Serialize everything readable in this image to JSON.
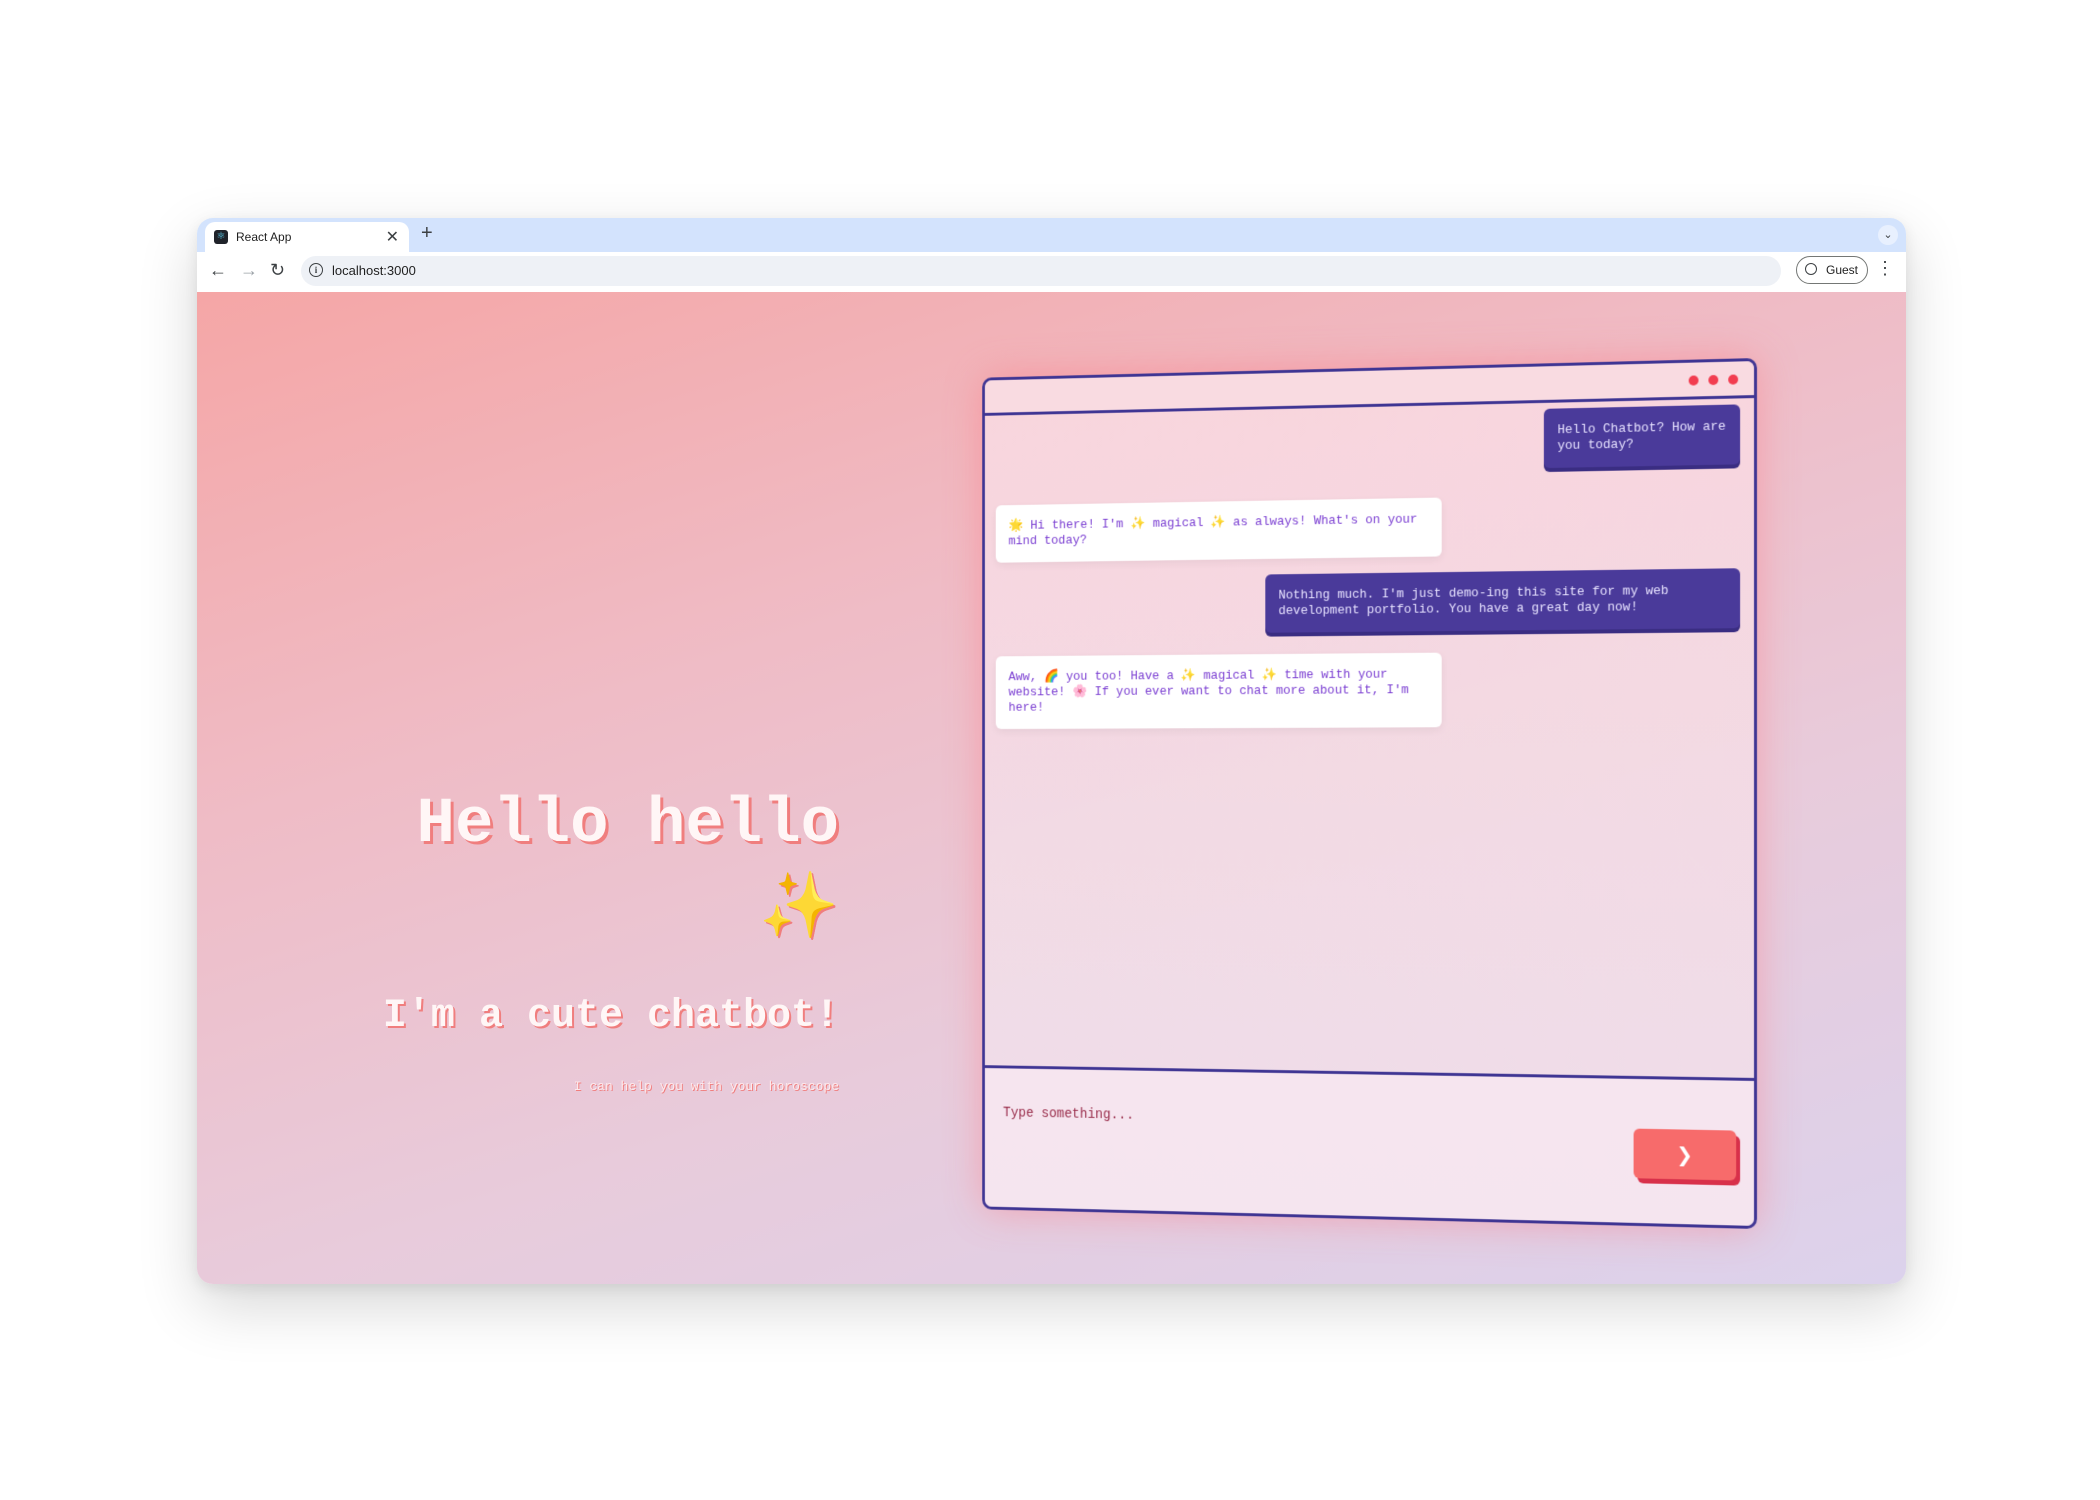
{
  "browser": {
    "tab_title": "React App",
    "tab_close": "✕",
    "new_tab": "+",
    "url": "localhost:3000",
    "profile_label": "Guest"
  },
  "hero": {
    "title": "Hello hello",
    "sparkle": "✨",
    "subtitle": "I'm a cute chatbot!",
    "tagline": "I can help you with your horoscope"
  },
  "chat": {
    "messages": [
      {
        "role": "user",
        "text": "Hello Chatbot? How are you today?"
      },
      {
        "role": "bot",
        "text": "🌟 Hi there! I'm ✨ magical ✨ as always! What's on your mind today?"
      },
      {
        "role": "user",
        "text": "Nothing much. I'm just demo-ing this site for my web development portfolio. You have a great day now!"
      },
      {
        "role": "bot",
        "text": "Aww, 🌈 you too! Have a ✨ magical ✨ time with your website! 🌸 If you ever want to chat more about it, I'm here!"
      }
    ],
    "input_placeholder": "Type something...",
    "send_icon": "❯"
  },
  "colors": {
    "accent": "#4a3a9a",
    "send_button": "#f76b6b",
    "window_dots": "#f23c4f"
  }
}
